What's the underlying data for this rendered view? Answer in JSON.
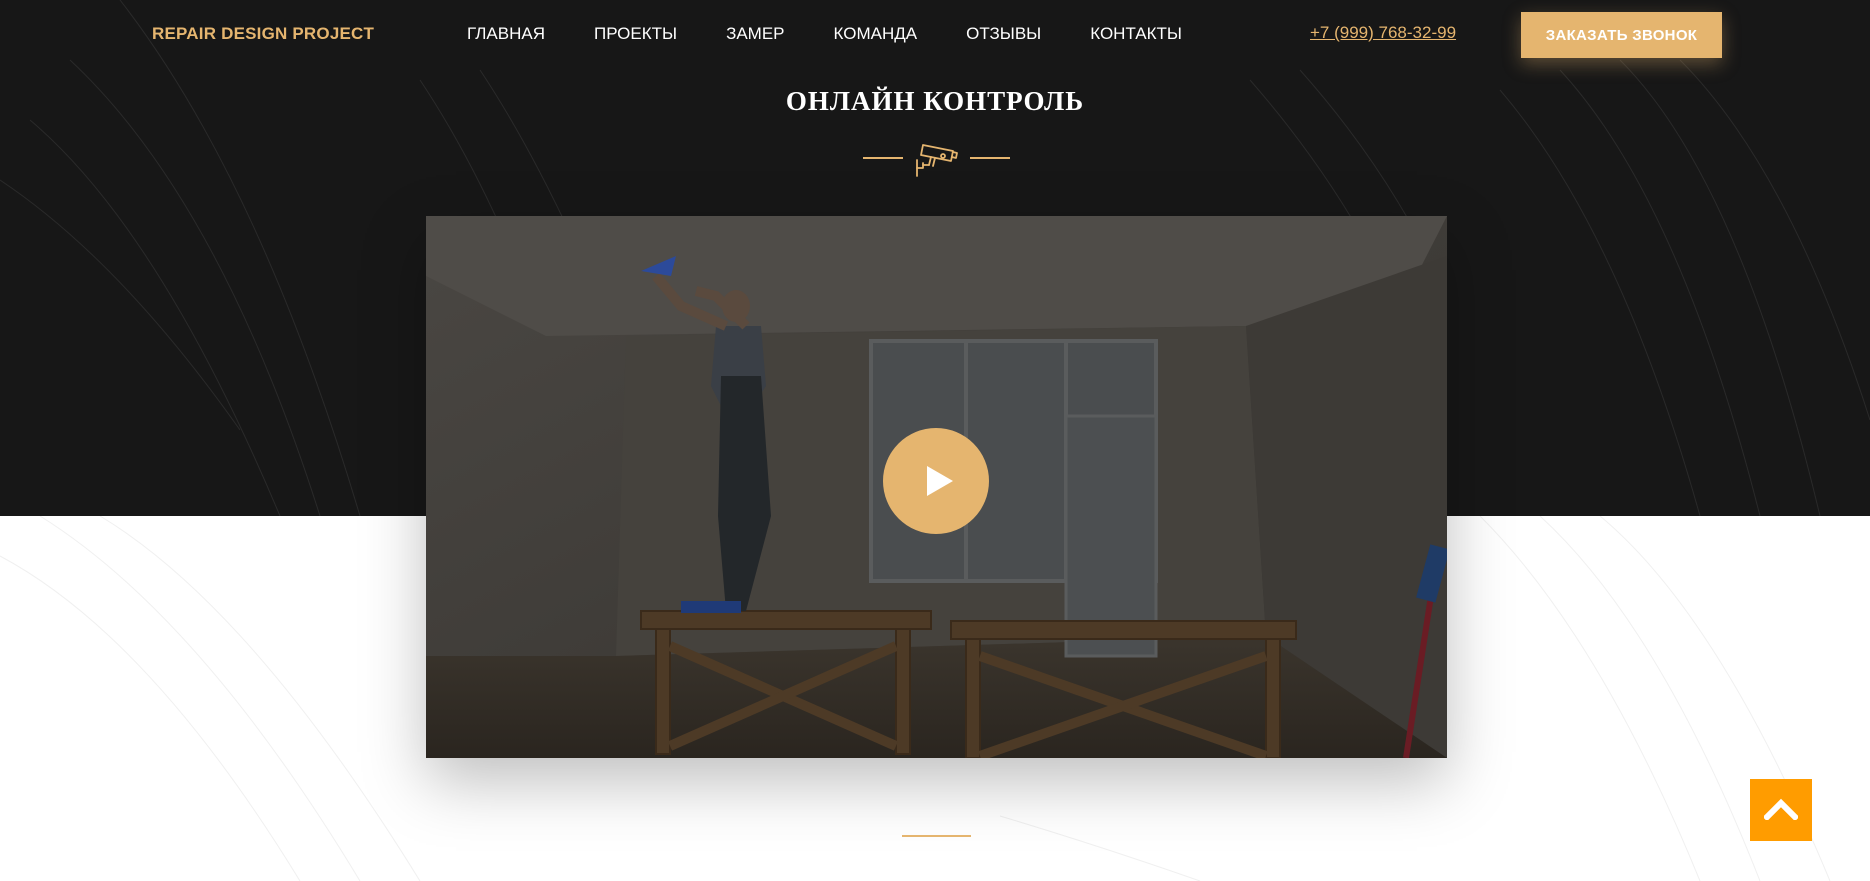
{
  "header": {
    "logo": "REPAIR DESIGN PROJECT",
    "nav": [
      {
        "label": "ГЛАВНАЯ"
      },
      {
        "label": "ПРОЕКТЫ"
      },
      {
        "label": "ЗАМЕР"
      },
      {
        "label": "КОМАНДА"
      },
      {
        "label": "ОТЗЫВЫ"
      },
      {
        "label": "КОНТАКТЫ"
      }
    ],
    "phone": "+7 (999) 768-32-99",
    "call_button": "ЗАКАЗАТЬ ЗВОНОК"
  },
  "section": {
    "title": "ОНЛАЙН КОНТРОЛЬ",
    "icon": "cctv-camera-icon"
  },
  "video": {
    "play_icon": "play-icon"
  },
  "scroll_top": {
    "icon": "chevron-up-icon"
  },
  "colors": {
    "accent": "#e5b56f",
    "dark_bg": "#171717",
    "scroll_top_bg": "#ff9c00",
    "text_light": "#ffffff"
  }
}
